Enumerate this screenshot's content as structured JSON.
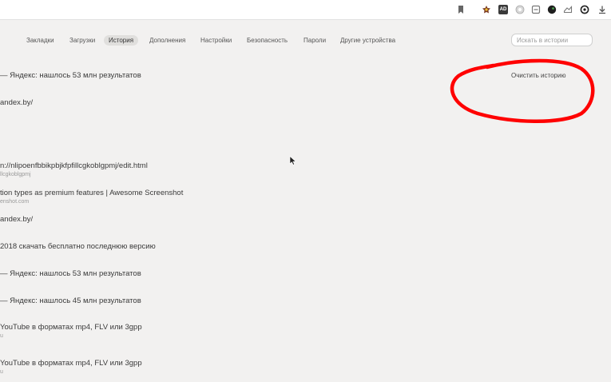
{
  "toolbar": {
    "icons": [
      "bookmark-icon",
      "extension-icon",
      "adblock-icon",
      "extension-icon",
      "extension-icon",
      "extension-icon",
      "extension-icon",
      "extension-icon",
      "download-icon"
    ]
  },
  "nav": {
    "tabs": [
      {
        "label": "Закладки"
      },
      {
        "label": "Загрузки"
      },
      {
        "label": "История"
      },
      {
        "label": "Дополнения"
      },
      {
        "label": "Настройки"
      },
      {
        "label": "Безопасность"
      },
      {
        "label": "Пароли"
      },
      {
        "label": "Другие устройства"
      }
    ],
    "active_tab": "История"
  },
  "search": {
    "placeholder": "Искать в истории"
  },
  "clear_history_label": "Очистить историю",
  "toolbar_badge": "AD",
  "entries": [
    {
      "title": "— Яндекс: нашлось 53 млн результатов",
      "domain": ""
    },
    {
      "title": "andex.by/",
      "domain": ""
    },
    {
      "title": "n://nlipoenfbbikpbjkfpfillcgkoblgpmj/edit.html",
      "domain": "llcgkoblgpmj"
    },
    {
      "title": "tion types as premium features | Awesome Screenshot",
      "domain": "enshot.com"
    },
    {
      "title": "andex.by/",
      "domain": ""
    },
    {
      "title": "2018 скачать бесплатно последнюю версию",
      "domain": ""
    },
    {
      "title": "— Яндекс: нашлось 53 млн результатов",
      "domain": ""
    },
    {
      "title": "— Яндекс: нашлось 45 млн результатов",
      "domain": ""
    },
    {
      "title": "YouTube в форматах mp4, FLV или 3gpp",
      "domain": "u"
    },
    {
      "title": "YouTube в форматах mp4, FLV или 3gpp",
      "domain": "u"
    }
  ],
  "colors": {
    "background": "#f2f1f0",
    "annotation_stroke": "#ff0000",
    "active_tab_bg": "#e0dfdd"
  }
}
